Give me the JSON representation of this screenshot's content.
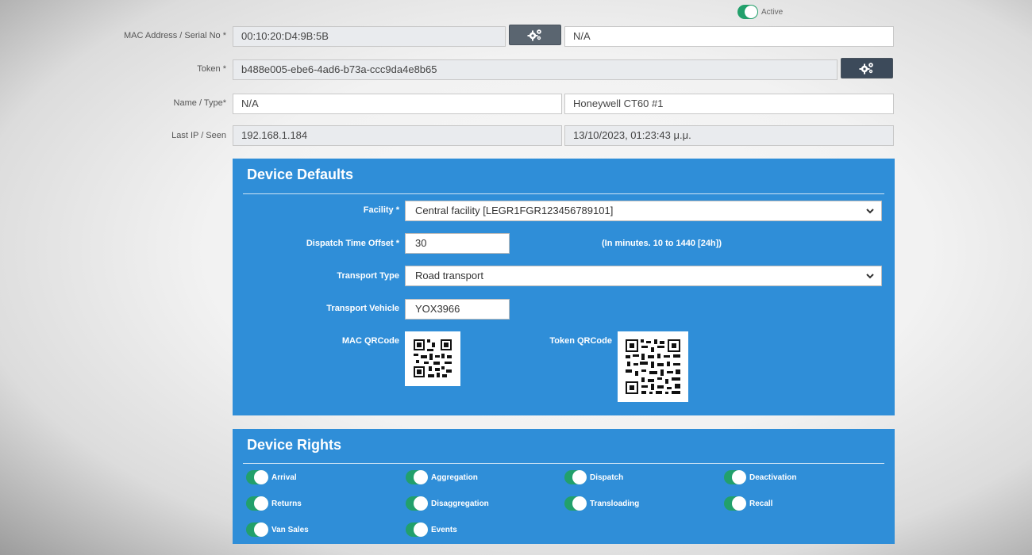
{
  "status": {
    "active_label": "Active"
  },
  "form": {
    "mac": {
      "label": "MAC Address / Serial No *",
      "value": "00:10:20:D4:9B:5B",
      "serial": "N/A"
    },
    "token": {
      "label": "Token *",
      "value": "b488e005-ebe6-4ad6-b73a-ccc9da4e8b65"
    },
    "name_type": {
      "label": "Name / Type*",
      "name": "N/A",
      "type": "Honeywell CT60 #1"
    },
    "last_ip": {
      "label": "Last IP / Seen",
      "ip": "192.168.1.184",
      "seen": "13/10/2023, 01:23:43 μ.μ."
    }
  },
  "defaults": {
    "title": "Device Defaults",
    "facility": {
      "label": "Facility *",
      "value": "Central facility [LEGR1FGR123456789101]"
    },
    "dispatch": {
      "label": "Dispatch Time Offset *",
      "value": "30",
      "hint": "(In minutes. 10 to 1440 [24h])"
    },
    "transport_type": {
      "label": "Transport Type",
      "value": "Road transport"
    },
    "transport_vehicle": {
      "label": "Transport Vehicle",
      "value": "YOX3966"
    },
    "mac_qr_label": "MAC QRCode",
    "token_qr_label": "Token QRCode"
  },
  "rights": {
    "title": "Device Rights",
    "items": [
      {
        "label": "Arrival",
        "enabled": true
      },
      {
        "label": "Aggregation",
        "enabled": true
      },
      {
        "label": "Dispatch",
        "enabled": true
      },
      {
        "label": "Deactivation",
        "enabled": true
      },
      {
        "label": "Returns",
        "enabled": true
      },
      {
        "label": "Disaggregation",
        "enabled": true
      },
      {
        "label": "Transloading",
        "enabled": true
      },
      {
        "label": "Recall",
        "enabled": true
      },
      {
        "label": "Van Sales",
        "enabled": true
      },
      {
        "label": "Events",
        "enabled": true
      }
    ]
  },
  "colors": {
    "panel": "#2f8ed8",
    "toggle_on": "#22a06b",
    "gear_button": "#5a6570"
  }
}
